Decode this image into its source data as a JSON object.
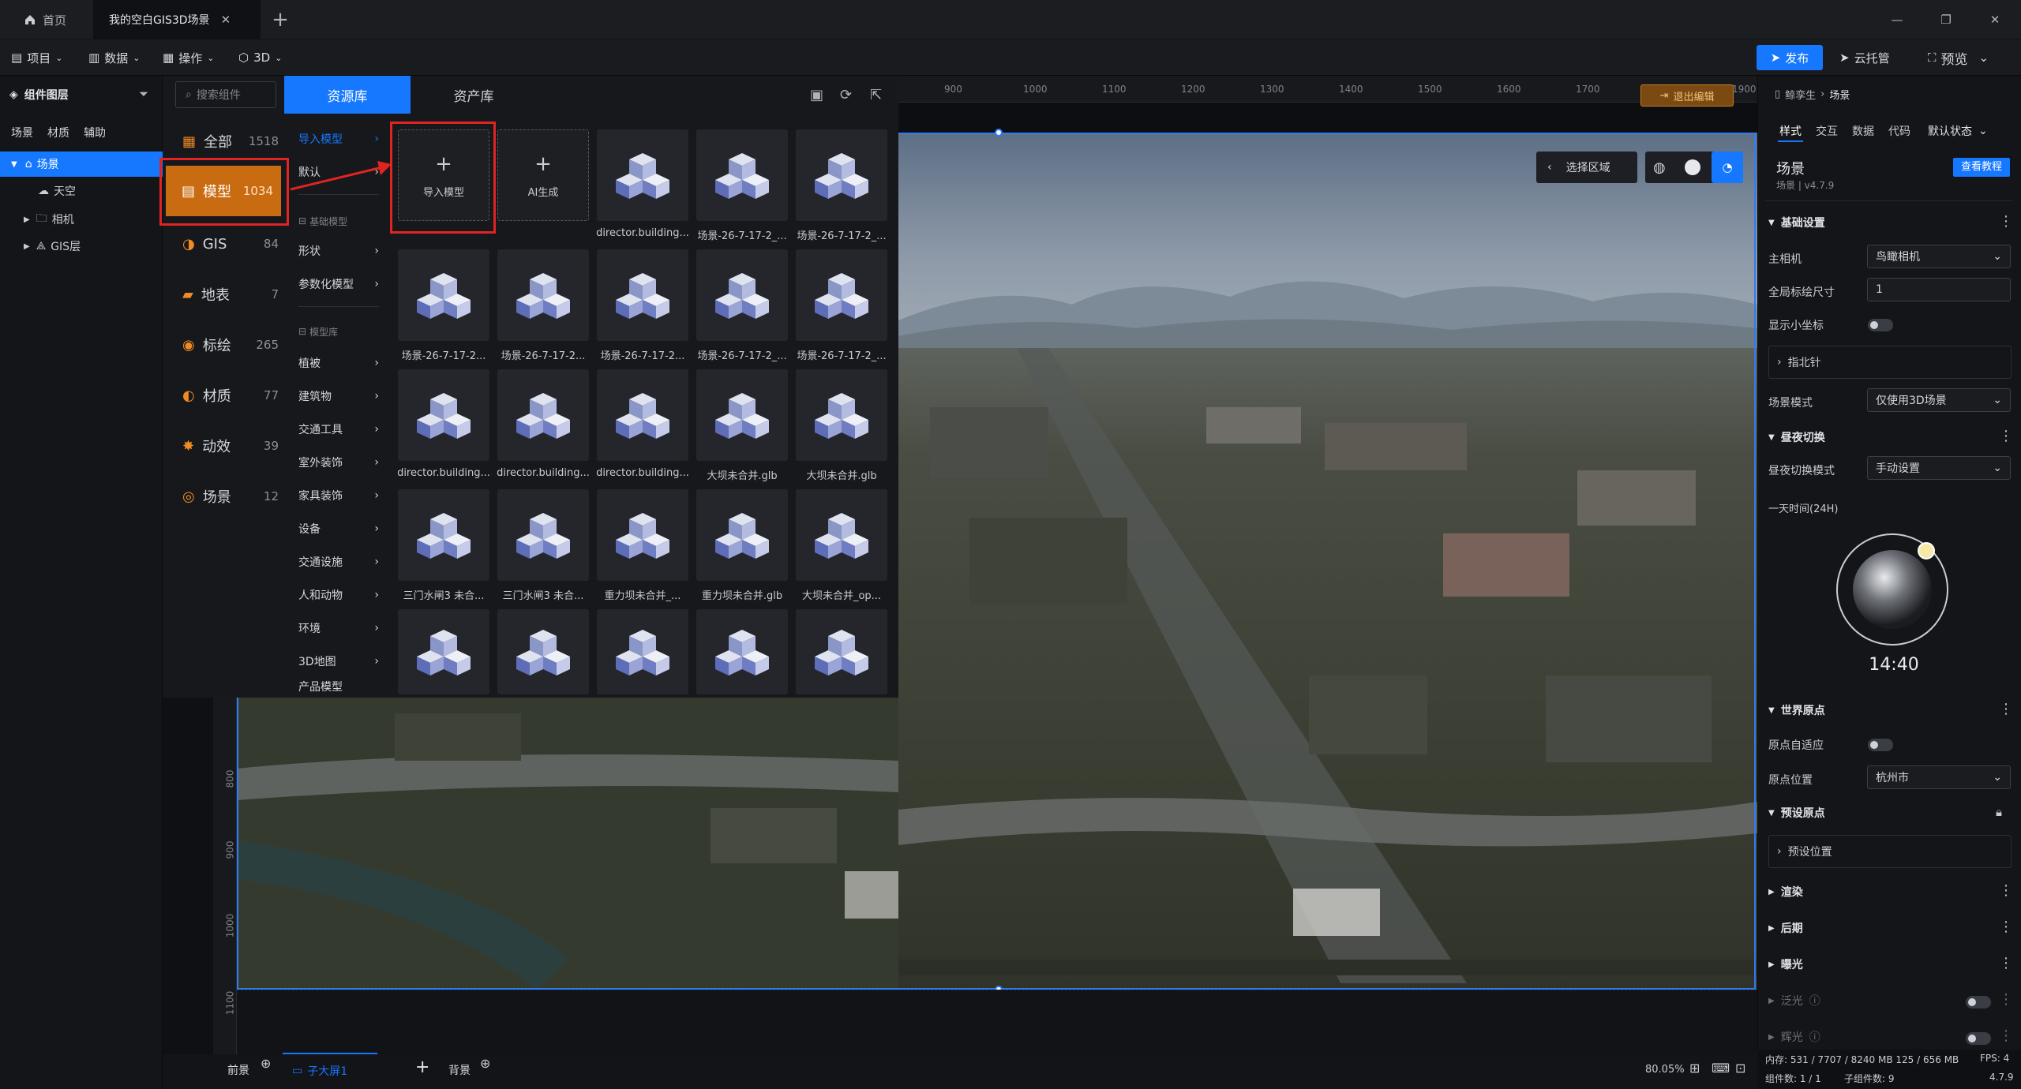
{
  "tabs": [
    {
      "label": "首页",
      "icon": "home-icon"
    },
    {
      "label": "我的空白GIS3D场景",
      "icon": "close-icon"
    }
  ],
  "menubar": {
    "items": [
      "项目",
      "数据",
      "操作",
      "3D"
    ],
    "publish": "发布",
    "cloud": "云托管",
    "preview": "预览"
  },
  "layers": {
    "title": "组件图层",
    "subtabs": [
      "场景",
      "材质",
      "辅助"
    ],
    "tree": [
      "场景",
      "天空",
      "相机",
      "GIS层"
    ]
  },
  "resource": {
    "search_placeholder": "搜索组件",
    "tab_lib": "资源库",
    "tab_asset": "资产库",
    "categories": [
      {
        "label": "全部",
        "count": "1518"
      },
      {
        "label": "模型",
        "count": "1034"
      },
      {
        "label": "GIS",
        "count": "84"
      },
      {
        "label": "地表",
        "count": "7"
      },
      {
        "label": "标绘",
        "count": "265"
      },
      {
        "label": "材质",
        "count": "77"
      },
      {
        "label": "动效",
        "count": "39"
      },
      {
        "label": "场景",
        "count": "12"
      }
    ],
    "sub_top": [
      "导入模型",
      "默认"
    ],
    "head_basic": "基础模型",
    "sub_basic": [
      "形状",
      "参数化模型"
    ],
    "head_lib": "模型库",
    "sub_lib": [
      "植被",
      "建筑物",
      "交通工具",
      "室外装饰",
      "家具装饰",
      "设备",
      "交通设施",
      "人和动物",
      "环境",
      "3D地图",
      "产品模型"
    ],
    "import_label": "导入模型",
    "ai_label": "AI生成",
    "cards": [
      "director.building...",
      "场景-26-7-17-2_...",
      "场景-26-7-17-2_...",
      "场景-26-7-17-2...",
      "场景-26-7-17-2...",
      "场景-26-7-17-2...",
      "场景-26-7-17-2_...",
      "场景-26-7-17-2_...",
      "director.building...",
      "director.building...",
      "director.building...",
      "大坝未合并.glb",
      "大坝未合并.glb",
      "三门水闸3 未合...",
      "三门水闸3 未合...",
      "重力坝未合并_...",
      "重力坝未合并.glb",
      "大坝未合并_op...",
      "",
      "",
      "",
      "",
      ""
    ]
  },
  "viewport": {
    "ruler_top": [
      "900",
      "1000",
      "1100",
      "1200",
      "1300",
      "1400",
      "1500",
      "1600",
      "1700",
      "1900"
    ],
    "ruler_left": [
      "800",
      "900",
      "1000",
      "1100"
    ],
    "exit_edit": "退出编辑",
    "select_area": "选择区域",
    "zoom": "80.05%"
  },
  "bottom": {
    "front": "前景",
    "screen": "子大屏1",
    "back": "背景"
  },
  "props": {
    "breadcrumb_user": "鲸孪生",
    "breadcrumb_page": "场景",
    "tabs": [
      "样式",
      "交互",
      "数据",
      "代码"
    ],
    "state": "默认状态",
    "title": "场景",
    "version": "场景 | v4.7.9",
    "tutorial": "查看教程",
    "sec_basic": "基础设置",
    "main_camera_label": "主相机",
    "main_camera_value": "鸟瞰相机",
    "global_size_label": "全局标绘尺寸",
    "global_size_value": "1",
    "show_axis_label": "显示小坐标",
    "compass": "指北针",
    "scene_mode_label": "场景模式",
    "scene_mode_value": "仅使用3D场景",
    "sec_daynight": "昼夜切换",
    "daynight_mode_label": "昼夜切换模式",
    "daynight_mode_value": "手动设置",
    "day_time_label": "一天时间(24H)",
    "time": "14:40",
    "sec_origin": "世界原点",
    "origin_auto_label": "原点自适应",
    "origin_pos_label": "原点位置",
    "origin_pos_value": "杭州市",
    "sec_preset": "预设原点",
    "preset_pos": "预设位置",
    "sec_render": "渲染",
    "sec_post": "后期",
    "sec_exposure": "曝光",
    "sec_bloom": "泛光",
    "sec_glow": "辉光",
    "status_mem": "内存: 531 / 7707 / 8240 MB  125 / 656 MB",
    "status_fps": "FPS: 4",
    "status_count": "组件数: 1 / 1",
    "status_sub": "子组件数: 9",
    "status_ver": "4.7.9"
  }
}
